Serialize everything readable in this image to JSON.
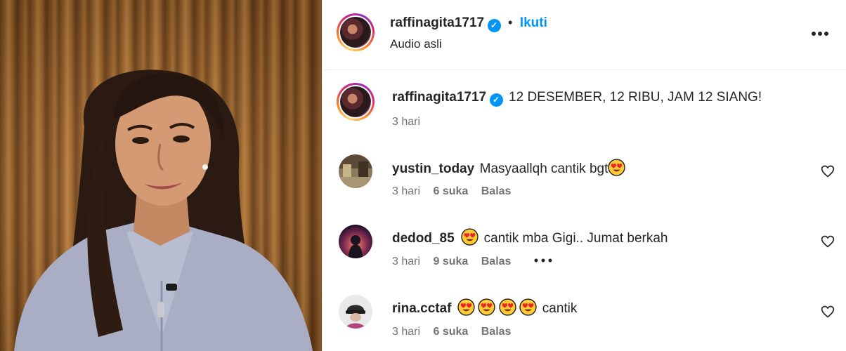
{
  "header": {
    "username": "raffinagita1717",
    "separator": "•",
    "follow_label": "Ikuti",
    "subtitle": "Audio asli",
    "menu_icon": "more-horizontal-icon"
  },
  "caption": {
    "username": "raffinagita1717",
    "text": "12 DESEMBER, 12 RIBU, JAM 12 SIANG!",
    "time": "3 hari"
  },
  "comments": [
    {
      "username": "yustin_today",
      "text": "Masyaallqh cantik bgt",
      "time": "3 hari",
      "likes": "6 suka",
      "reply": "Balas"
    },
    {
      "username": "dedod_85",
      "text": "cantik mba Gigi.. Jumat berkah",
      "time": "3 hari",
      "likes": "9 suka",
      "reply": "Balas"
    },
    {
      "username": "rina.cctaf",
      "text": "cantik",
      "time": "3 hari",
      "likes": "6 suka",
      "reply": "Balas"
    }
  ],
  "colors": {
    "accent": "#0095f6",
    "text": "#262626",
    "secondary": "#737373"
  }
}
